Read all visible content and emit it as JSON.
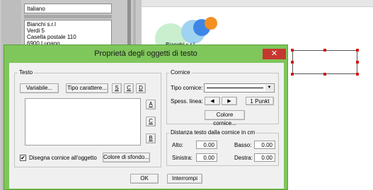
{
  "background_app": {
    "language_value": "Italiano",
    "address_lines": [
      "Bianchi s.r.l",
      "Verdi 5",
      "Casella postale 110",
      "6900 Lugano"
    ],
    "logo_caption": "Bianchi s.r.l",
    "logo_colors": {
      "circle1": "#c9efcf",
      "circle2": "#9fd3ef",
      "circle3": "#3d86e6",
      "circle4": "#f48f22"
    }
  },
  "dialog": {
    "title": "Proprietà degli oggetti di testo",
    "close_icon": "close-icon",
    "testo": {
      "group_label": "Testo",
      "variable_button": "Variabile...",
      "font_button": "Tipo carattere...",
      "style_buttons": [
        "S",
        "C",
        "D"
      ],
      "align_buttons": [
        "A",
        "C",
        "B"
      ],
      "draw_frame_checked": true,
      "draw_frame_label": "Disegna cornice all'oggetto",
      "bg_color_button": "Colore di sfondo..."
    },
    "cornice": {
      "group_label": "Cornice",
      "frame_type_label": "Tipo cornice:",
      "line_width_label": "Spess. linea:",
      "line_width_value": "1 Punkt",
      "frame_color_button": "Colore cornice..."
    },
    "distance": {
      "group_label": "Distanza testo dalla cornice in cm",
      "top_label": "Alto:",
      "top_value": "0.00",
      "bottom_label": "Basso:",
      "bottom_value": "0.00",
      "left_label": "Sinistra:",
      "left_value": "0.00",
      "right_label": "Destra:",
      "right_value": "0.00"
    },
    "ok_button": "OK",
    "cancel_button": "Interrompi",
    "colors": {
      "titlebar": "#7fc65b",
      "close": "#c7372f"
    }
  }
}
